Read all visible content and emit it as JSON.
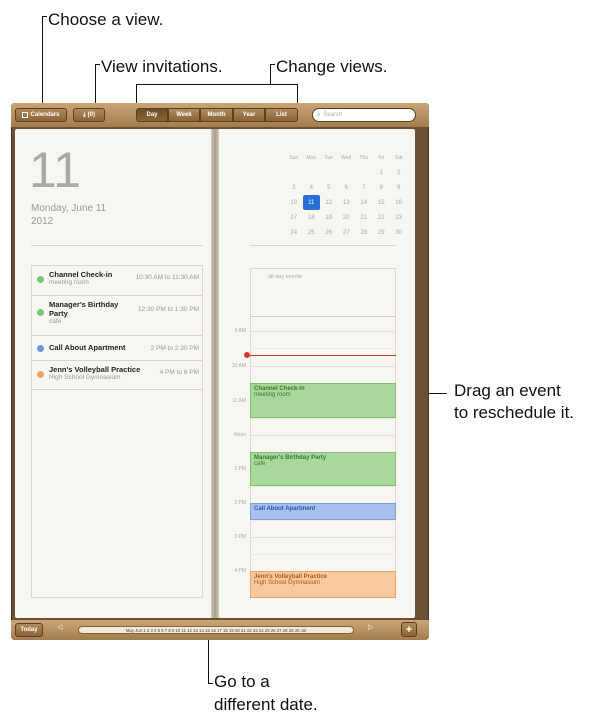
{
  "callouts": {
    "choose_view": "Choose a view.",
    "view_invitations": "View invitations.",
    "change_views": "Change views.",
    "drag_event": [
      "Drag an event",
      "to reschedule it."
    ],
    "go_to_date": [
      "Go to a",
      "different date."
    ]
  },
  "toolbar": {
    "calendars": "Calendars",
    "inbox": "(0)",
    "views": [
      "Day",
      "Week",
      "Month",
      "Year",
      "List"
    ],
    "selected_view": "Day",
    "search_placeholder": "Search"
  },
  "day_page": {
    "day_number": "11",
    "weekday_date": "Monday, June 11",
    "year": "2012"
  },
  "events": [
    {
      "title": "Channel Check-in",
      "location": "meeting room",
      "time": "10:30 AM to 11:30 AM",
      "color": "#7cc576"
    },
    {
      "title": "Manager's Birthday Party",
      "location": "cafe",
      "time": "12:30 PM to 1:30 PM",
      "color": "#7cc576"
    },
    {
      "title": "Call About Apartment",
      "location": "",
      "time": "2 PM to 2:30 PM",
      "color": "#6f97d8"
    },
    {
      "title": "Jenn's Volleyball Practice",
      "location": "High School Gymnasium",
      "time": "4 PM to 6 PM",
      "color": "#f0a35e"
    }
  ],
  "mini_calendar": {
    "headers": [
      "Sun",
      "Mon",
      "Tue",
      "Wed",
      "Thu",
      "Fri",
      "Sat"
    ],
    "weeks": [
      [
        "",
        "",
        "",
        "",
        "",
        "1",
        "2"
      ],
      [
        "3",
        "4",
        "5",
        "6",
        "7",
        "8",
        "9"
      ],
      [
        "10",
        "11",
        "12",
        "13",
        "14",
        "15",
        "16"
      ],
      [
        "17",
        "18",
        "19",
        "20",
        "21",
        "22",
        "23"
      ],
      [
        "24",
        "25",
        "26",
        "27",
        "28",
        "29",
        "30"
      ]
    ],
    "selected": "11"
  },
  "day_grid": {
    "all_day_label": "all-day events",
    "hours": [
      "9 AM",
      "10 AM",
      "11 AM",
      "Noon",
      "1 PM",
      "2 PM",
      "3 PM",
      "4 PM"
    ],
    "events": [
      {
        "title": "Channel Check-in",
        "location": "meeting room",
        "bg": "#a8d89a",
        "fg": "#3d7a32"
      },
      {
        "title": "Manager's Birthday Party",
        "location": "cafe",
        "bg": "#a8d89a",
        "fg": "#3d7a32"
      },
      {
        "title": "Call About Apartment",
        "location": "",
        "bg": "#a8c0ee",
        "fg": "#2d55a8"
      },
      {
        "title": "Jenn's Volleyball Practice",
        "location": "High School Gymnasium",
        "bg": "#f8c99e",
        "fg": "#b35a12"
      }
    ]
  },
  "bottom": {
    "today": "Today",
    "timeline": "May  Jun 1 2 3 4 5 6 7 8 9 10 11 12 13 14 15 16 17 18 19 20 21 22 23 24 25 26 27 28 29 30  Jul",
    "add": "+",
    "prev": "◁",
    "next": "▷"
  }
}
